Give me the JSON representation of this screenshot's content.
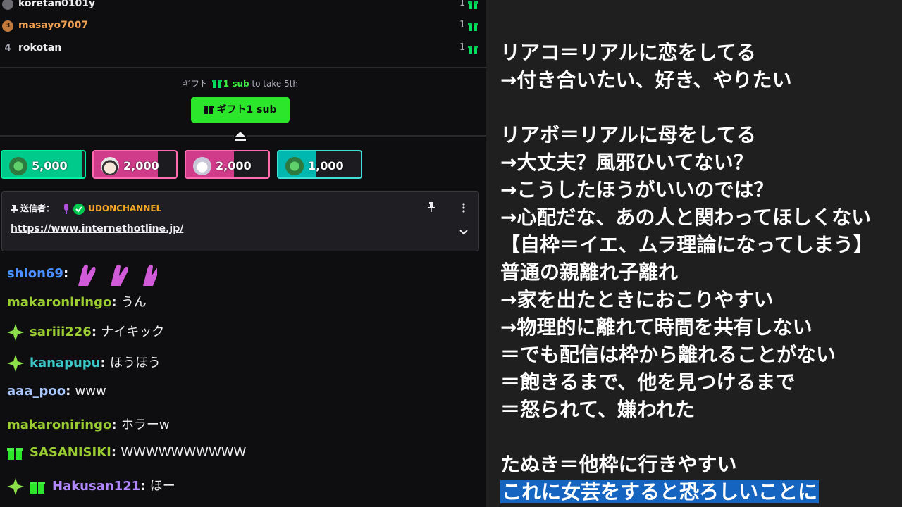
{
  "leaderboard": [
    {
      "rank": "",
      "name": "koretan0101y",
      "count": "1",
      "name_color": "#efeff1",
      "rank_bg": "#6a6a70"
    },
    {
      "rank": "3",
      "name": "masayo7007",
      "count": "1",
      "name_color": "#f0a050",
      "rank_bg": "#c47a3a"
    },
    {
      "rank": "4",
      "name": "rokotan",
      "count": "1",
      "name_color": "#efeff1",
      "rank_bg": ""
    }
  ],
  "gift_hint": {
    "prefix": "ギフト",
    "highlight": "1 sub",
    "suffix": "to take 5th"
  },
  "gift_button": "ギフト1 sub",
  "hype_cards": [
    {
      "amount": "5,000",
      "fill": 0.97,
      "color": "#00c98c",
      "border": "#00f0a0",
      "avatar": "#2e7a3e"
    },
    {
      "amount": "2,000",
      "fill": 0.78,
      "color": "#d03c8a",
      "border": "#ff6ab0",
      "avatar": "#e6e6e6"
    },
    {
      "amount": "2,000",
      "fill": 0.58,
      "color": "#d03c8a",
      "border": "#ff6ab0",
      "avatar": "#d8d8e0"
    },
    {
      "amount": "1,000",
      "fill": 0.45,
      "color": "#00b8b0",
      "border": "#40e0d8",
      "avatar": "#2e7a3e"
    }
  ],
  "pinned": {
    "sender_label": "送信者：",
    "sender_name": "UDONCHANNEL",
    "link": "https://www.internethotline.jp/"
  },
  "messages": [
    {
      "user": "shion69",
      "color": "#4a90ff",
      "text": "",
      "badge": ""
    },
    {
      "user": "makaroniringo",
      "color": "#9acd32",
      "text": "うん",
      "badge": ""
    },
    {
      "user": "sariii226",
      "color": "#9acd32",
      "text": "ナイキック",
      "badge": "sparkle"
    },
    {
      "user": "kanapupu",
      "color": "#3cc8c8",
      "text": "ほうほう",
      "badge": "sparkle"
    },
    {
      "user": "aaa_poo",
      "color": "#a8c8ff",
      "text": "www",
      "badge": ""
    },
    {
      "user": "makaroniringo",
      "color": "#9acd32",
      "text": "ホラーw",
      "badge": ""
    },
    {
      "user": "SASANISIKI",
      "color": "#9acd32",
      "text": "WWWWWWWWWW",
      "badge": "gift"
    },
    {
      "user": "Hakusan121",
      "color": "#b088ff",
      "text": "ほー",
      "badge": "sparkle+gift"
    }
  ],
  "notes": [
    "リアコ＝リアルに恋をしてる",
    "→付き合いたい、好き、やりたい",
    "",
    "リアボ＝リアルに母をしてる",
    "→大丈夫？風邪ひいてない？",
    "→こうしたほうがいいのでは？",
    "→心配だな、あの人と関わってほしくない",
    "【自枠＝イエ、ムラ理論になってしまう】",
    "普通の親離れ子離れ",
    "→家を出たときにおこりやすい",
    "→物理的に離れて時間を共有しない",
    "＝でも配信は枠から離れることがない",
    "＝飽きるまで、他を見つけるまで",
    "＝怒られて、嫌われた",
    "",
    "たぬき＝他枠に行きやすい"
  ],
  "note_selected": "これに女芸をすると恐ろしいことに"
}
